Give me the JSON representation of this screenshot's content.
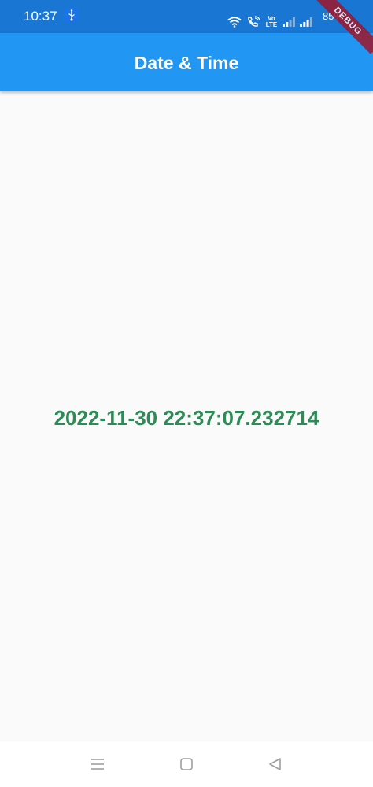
{
  "status_bar": {
    "time": "10:37",
    "battery": "85%",
    "volte_line1": "Vo",
    "volte_line2": "LTE",
    "icons": [
      "usb-icon",
      "wifi-icon",
      "wifi-calling-icon",
      "volte-icon",
      "signal-icon",
      "signal-icon",
      "battery-icon"
    ]
  },
  "app_bar": {
    "title": "Date & Time"
  },
  "debug_banner": "DEBUG",
  "main": {
    "datetime": "2022-11-30 22:37:07.232714"
  },
  "nav_bar": {
    "buttons": [
      "menu-icon",
      "home-icon",
      "back-icon"
    ]
  },
  "colors": {
    "status_bar": "#1976d2",
    "app_bar": "#2196f3",
    "datetime_text": "#2e8b57",
    "background": "#fafafa",
    "debug_banner": "#a0162b"
  }
}
